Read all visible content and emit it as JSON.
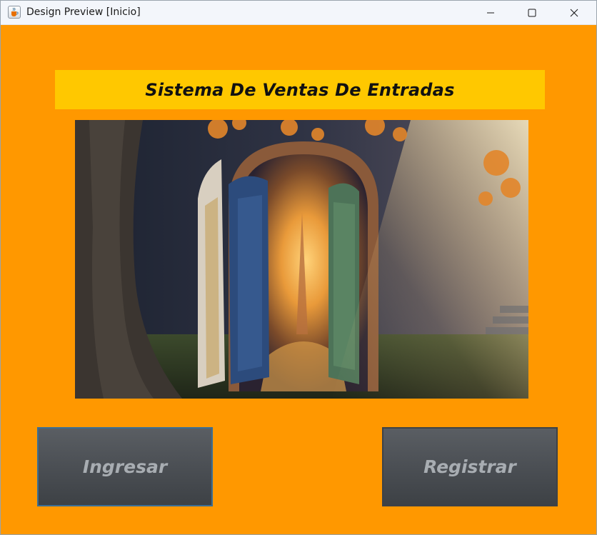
{
  "window": {
    "title": "Design Preview [Inicio]",
    "icon": "java-cup-icon",
    "controls": [
      "minimize-icon",
      "maximize-icon",
      "close-icon"
    ]
  },
  "main": {
    "heading": "Sistema De Ventas De Entradas",
    "image": "enchanted-arched-doorway-illustration",
    "buttons": {
      "ingresar": "Ingresar",
      "registrar": "Registrar"
    }
  },
  "colors": {
    "background": "#ff9800",
    "banner": "#ffc800",
    "button": "#4b4f54",
    "button_text": "#a8adb2"
  }
}
